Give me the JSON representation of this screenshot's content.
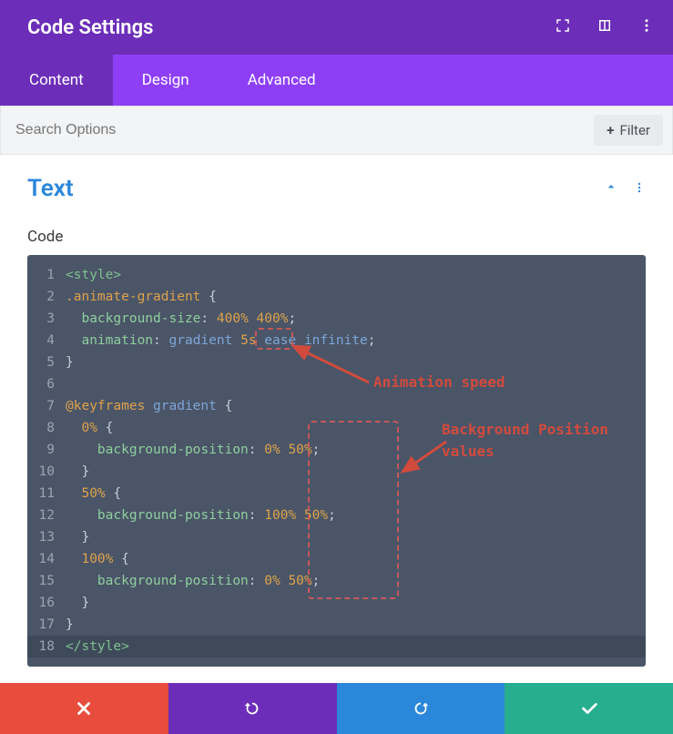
{
  "header": {
    "title": "Code Settings"
  },
  "tabs": [
    {
      "label": "Content",
      "active": true
    },
    {
      "label": "Design",
      "active": false
    },
    {
      "label": "Advanced",
      "active": false
    }
  ],
  "search": {
    "placeholder": "Search Options"
  },
  "filter": {
    "label": "Filter"
  },
  "section": {
    "title": "Text",
    "code_label": "Code"
  },
  "code": {
    "lines": [
      {
        "n": 1,
        "tokens": [
          [
            "tag",
            "<style>"
          ]
        ]
      },
      {
        "n": 2,
        "tokens": [
          [
            "sel",
            ".animate-gradient"
          ],
          [
            "punc",
            " {"
          ]
        ]
      },
      {
        "n": 3,
        "tokens": [
          [
            "plain",
            "  "
          ],
          [
            "prop",
            "background-size"
          ],
          [
            "punc",
            ": "
          ],
          [
            "num",
            "400% 400%"
          ],
          [
            "punc",
            ";"
          ]
        ]
      },
      {
        "n": 4,
        "tokens": [
          [
            "plain",
            "  "
          ],
          [
            "prop",
            "animation"
          ],
          [
            "punc",
            ": "
          ],
          [
            "ident",
            "gradient "
          ],
          [
            "num",
            "5s"
          ],
          [
            "ident",
            " ease infinite"
          ],
          [
            "punc",
            ";"
          ]
        ]
      },
      {
        "n": 5,
        "tokens": [
          [
            "punc",
            "}"
          ]
        ]
      },
      {
        "n": 6,
        "tokens": [
          [
            "plain",
            ""
          ]
        ]
      },
      {
        "n": 7,
        "tokens": [
          [
            "sel",
            "@keyframes "
          ],
          [
            "ident",
            "gradient"
          ],
          [
            "punc",
            " {"
          ]
        ]
      },
      {
        "n": 8,
        "tokens": [
          [
            "plain",
            "  "
          ],
          [
            "sel",
            "0%"
          ],
          [
            "punc",
            " {"
          ]
        ]
      },
      {
        "n": 9,
        "tokens": [
          [
            "plain",
            "    "
          ],
          [
            "prop",
            "background-position"
          ],
          [
            "punc",
            ": "
          ],
          [
            "num",
            "0% 50%"
          ],
          [
            "punc",
            ";"
          ]
        ]
      },
      {
        "n": 10,
        "tokens": [
          [
            "plain",
            "  "
          ],
          [
            "punc",
            "}"
          ]
        ]
      },
      {
        "n": 11,
        "tokens": [
          [
            "plain",
            "  "
          ],
          [
            "sel",
            "50%"
          ],
          [
            "punc",
            " {"
          ]
        ]
      },
      {
        "n": 12,
        "tokens": [
          [
            "plain",
            "    "
          ],
          [
            "prop",
            "background-position"
          ],
          [
            "punc",
            ": "
          ],
          [
            "num",
            "100% 50%"
          ],
          [
            "punc",
            ";"
          ]
        ]
      },
      {
        "n": 13,
        "tokens": [
          [
            "plain",
            "  "
          ],
          [
            "punc",
            "}"
          ]
        ]
      },
      {
        "n": 14,
        "tokens": [
          [
            "plain",
            "  "
          ],
          [
            "sel",
            "100%"
          ],
          [
            "punc",
            " {"
          ]
        ]
      },
      {
        "n": 15,
        "tokens": [
          [
            "plain",
            "    "
          ],
          [
            "prop",
            "background-position"
          ],
          [
            "punc",
            ": "
          ],
          [
            "num",
            "0% 50%"
          ],
          [
            "punc",
            ";"
          ]
        ]
      },
      {
        "n": 16,
        "tokens": [
          [
            "plain",
            "  "
          ],
          [
            "punc",
            "}"
          ]
        ]
      },
      {
        "n": 17,
        "tokens": [
          [
            "punc",
            "}"
          ]
        ]
      },
      {
        "n": 18,
        "tokens": [
          [
            "tag",
            "</style>"
          ]
        ],
        "hl": true
      }
    ]
  },
  "annotations": {
    "speed_label": "Animation speed",
    "bgpos_label": "Background Position values"
  }
}
